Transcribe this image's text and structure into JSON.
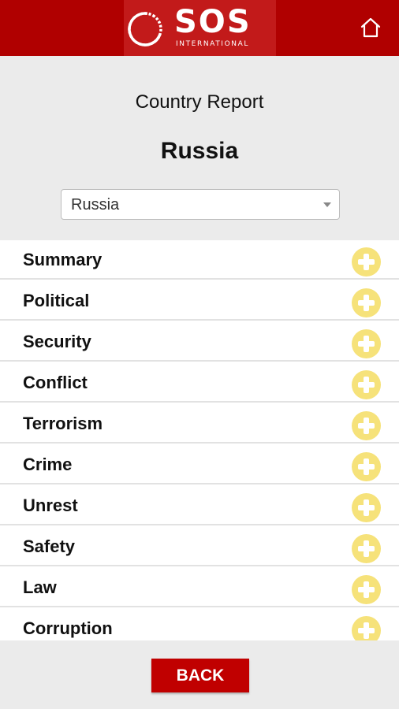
{
  "header": {
    "logo": {
      "name": "SOS",
      "subtitle": "INTERNATIONAL",
      "icon": "ring-logo-icon"
    },
    "home_icon": "home-icon"
  },
  "page": {
    "heading": "Country Report",
    "country": "Russia"
  },
  "country_select": {
    "selected": "Russia",
    "caret_icon": "dropdown-caret-icon"
  },
  "sections": [
    {
      "label": "Summary"
    },
    {
      "label": "Political"
    },
    {
      "label": "Security"
    },
    {
      "label": "Conflict"
    },
    {
      "label": "Terrorism"
    },
    {
      "label": "Crime"
    },
    {
      "label": "Unrest"
    },
    {
      "label": "Safety"
    },
    {
      "label": "Law"
    },
    {
      "label": "Corruption"
    }
  ],
  "footer": {
    "back_label": "BACK"
  },
  "colors": {
    "brand_red": "#b00000",
    "button_red": "#c00000",
    "expand_yellow": "#f6e27a",
    "background": "#ebebeb"
  }
}
